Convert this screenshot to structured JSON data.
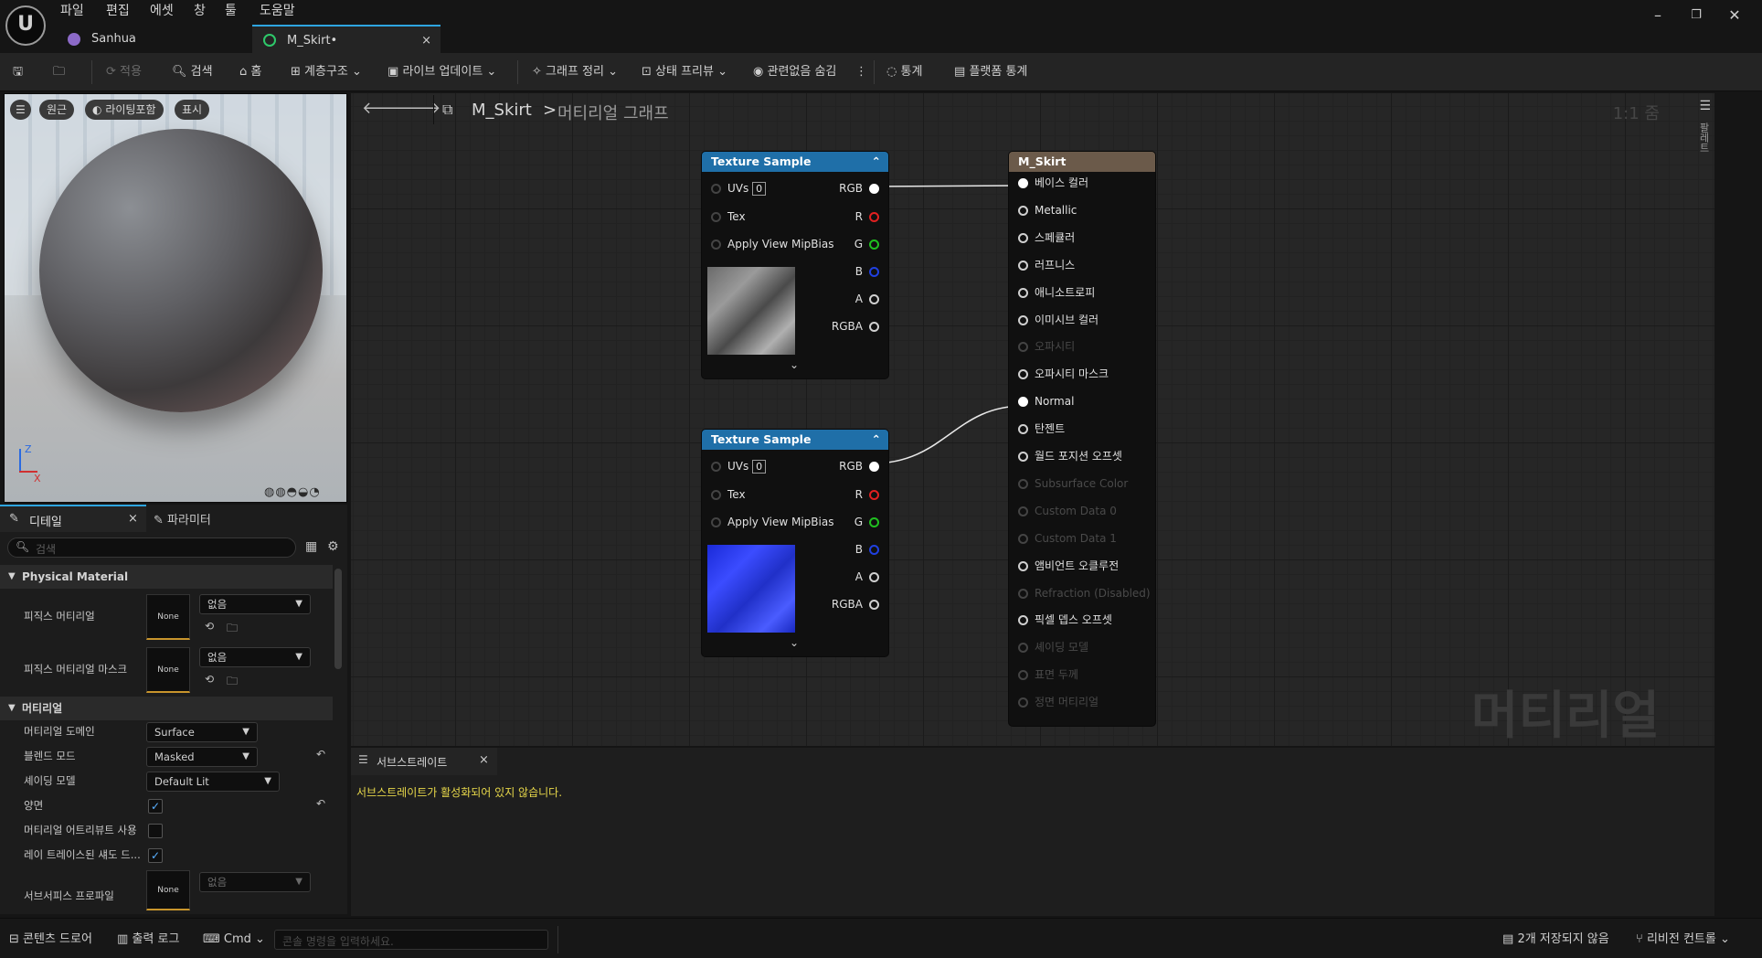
{
  "menu": [
    "파일",
    "편집",
    "에셋",
    "창",
    "툴",
    "도움말"
  ],
  "tabs": [
    {
      "label": "Sanhua"
    },
    {
      "label": "M_Skirt•"
    }
  ],
  "toolbar": {
    "apply": "적용",
    "search": "검색",
    "home": "홈",
    "hierarchy": "계층구조",
    "live_update": "라이브 업데이트",
    "graph_cleanup": "그래프 정리",
    "state_preview": "상태 프리뷰",
    "hide_unrelated": "관련없음 숨김",
    "stats": "통계",
    "platform_stats": "플랫폼 통계"
  },
  "viewport": {
    "perspective": "원근",
    "lit": "라이팅포함",
    "show": "표시",
    "axis_z": "Z",
    "axis_x": "X"
  },
  "details": {
    "tab_details": "디테일",
    "tab_params": "파라미터",
    "search_placeholder": "검색",
    "physical_material_section": "Physical Material",
    "phys_material": "피직스 머티리얼",
    "phys_material_value": "없음",
    "thumb_none": "None",
    "phys_mask": "피직스 머티리얼 마스크",
    "phys_mask_value": "없음",
    "material_section": "머티리얼",
    "domain_label": "머티리얼 도메인",
    "domain_value": "Surface",
    "blend_label": "블렌드 모드",
    "blend_value": "Masked",
    "shading_label": "셰이딩 모델",
    "shading_value": "Default Lit",
    "two_sided": "양면",
    "use_attr": "머티리얼 어트리뷰트 사용",
    "rt_shadow": "레이 트레이스된 섀도 드...",
    "subsurface_profile": "서브서피스 프로파일",
    "subsurface_value": "없음"
  },
  "graph": {
    "breadcrumb_asset": "M_Skirt",
    "breadcrumb_sep": ">",
    "breadcrumb_graph": "머티리얼 그래프",
    "zoom": "1:1 줌",
    "watermark": "머티리얼",
    "side_label": "팔레트",
    "node1": {
      "title": "Texture Sample",
      "uvs": "UVs",
      "uv_idx": "0",
      "tex": "Tex",
      "mip": "Apply View MipBias",
      "rgb": "RGB",
      "r": "R",
      "g": "G",
      "b": "B",
      "a": "A",
      "rgba": "RGBA",
      "more": "⌄"
    },
    "node2": {
      "title": "Texture Sample",
      "uvs": "UVs",
      "uv_idx": "0",
      "tex": "Tex",
      "mip": "Apply View MipBias",
      "rgb": "RGB",
      "r": "R",
      "g": "G",
      "b": "B",
      "a": "A",
      "rgba": "RGBA",
      "more": "⌄"
    },
    "result": {
      "title": "M_Skirt",
      "pins": [
        {
          "label": "베이스 컬러",
          "enabled": true
        },
        {
          "label": "Metallic",
          "enabled": true
        },
        {
          "label": "스페큘러",
          "enabled": true
        },
        {
          "label": "러프니스",
          "enabled": true
        },
        {
          "label": "애니소트로피",
          "enabled": true
        },
        {
          "label": "이미시브 컬러",
          "enabled": true
        },
        {
          "label": "오파시티",
          "enabled": false
        },
        {
          "label": "오파시티 마스크",
          "enabled": true
        },
        {
          "label": "Normal",
          "enabled": true
        },
        {
          "label": "탄젠트",
          "enabled": true
        },
        {
          "label": "월드 포지션 오프셋",
          "enabled": true
        },
        {
          "label": "Subsurface Color",
          "enabled": false
        },
        {
          "label": "Custom Data 0",
          "enabled": false
        },
        {
          "label": "Custom Data 1",
          "enabled": false
        },
        {
          "label": "앰비언트 오클루전",
          "enabled": true
        },
        {
          "label": "Refraction (Disabled)",
          "enabled": false
        },
        {
          "label": "픽셀 뎁스 오프셋",
          "enabled": true
        },
        {
          "label": "셰이딩 모델",
          "enabled": false
        },
        {
          "label": "표면 두께",
          "enabled": false
        },
        {
          "label": "정면 머티리얼",
          "enabled": false
        }
      ]
    }
  },
  "substrate": {
    "tab": "서브스트레이트",
    "message": "서브스트레이트가 활성화되어 있지 않습니다."
  },
  "bottom": {
    "content_drawer": "콘텐츠 드로어",
    "output_log": "출력 로그",
    "cmd": "Cmd",
    "console_placeholder": "콘솔 명령을 입력하세요.",
    "unsaved": "2개 저장되지 않음",
    "revision": "리비전 컨트롤"
  },
  "colors": {
    "accent": "#2ea5e0",
    "node_header": "#1f6fa8",
    "result_header": "#6b5a4a",
    "pin_r": "#e02020",
    "pin_g": "#20c020",
    "pin_b": "#2040e0",
    "warn": "#e8d84a"
  }
}
